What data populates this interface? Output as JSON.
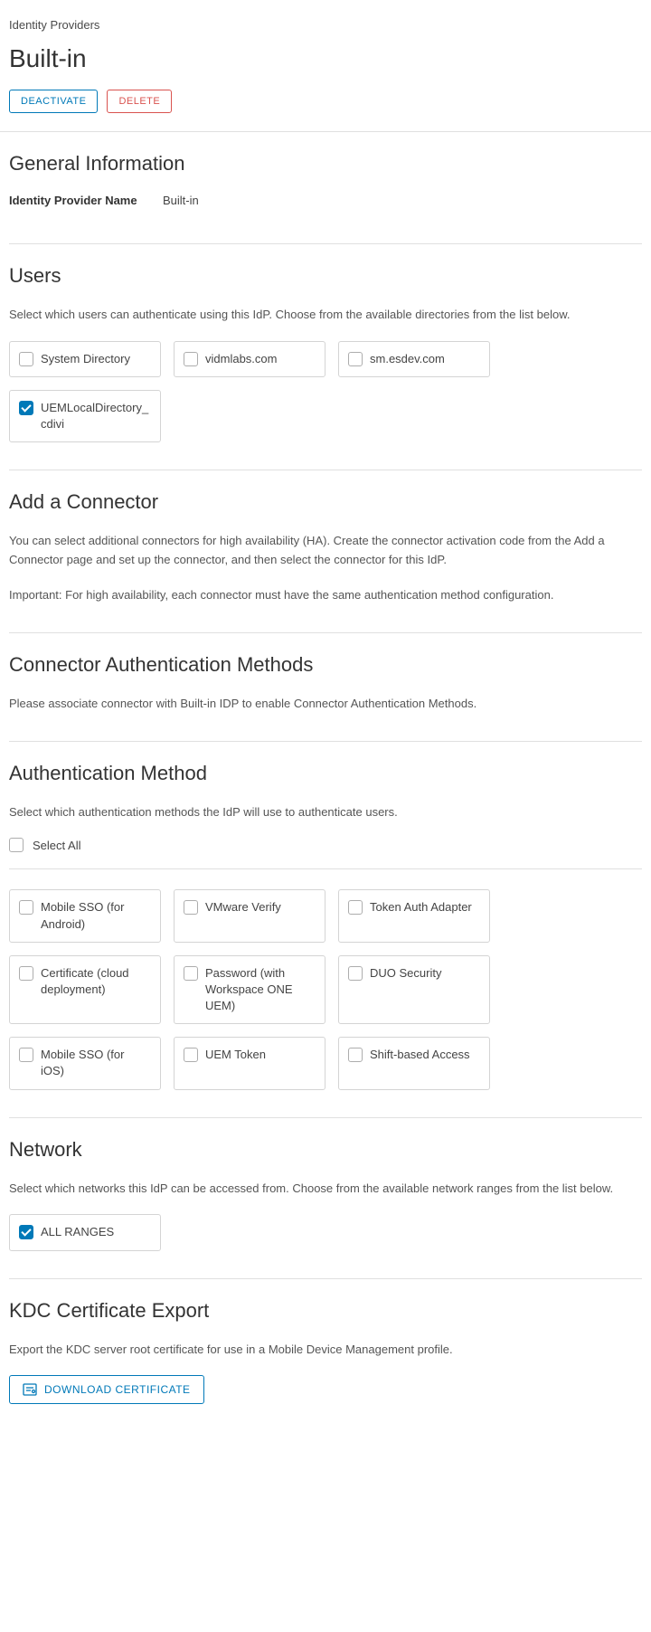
{
  "breadcrumb": "Identity Providers",
  "page_title": "Built-in",
  "actions": {
    "deactivate": "DEACTIVATE",
    "delete": "DELETE"
  },
  "general": {
    "heading": "General Information",
    "name_label": "Identity Provider Name",
    "name_value": "Built-in"
  },
  "users": {
    "heading": "Users",
    "desc": "Select which users can authenticate using this IdP. Choose from the available directories from the list below.",
    "items": [
      {
        "label": "System Directory",
        "checked": false
      },
      {
        "label": "vidmlabs.com",
        "checked": false
      },
      {
        "label": "sm.esdev.com",
        "checked": false
      },
      {
        "label": "UEMLocalDirectory_cdivi",
        "checked": true
      }
    ]
  },
  "connector": {
    "heading": "Add a Connector",
    "desc1": "You can select additional connectors for high availability (HA). Create the connector activation code from the Add a Connector page and set up the connector, and then select the connector for this IdP.",
    "desc2": "Important: For high availability, each connector must have the same authentication method configuration."
  },
  "conn_auth": {
    "heading": "Connector Authentication Methods",
    "desc": "Please associate connector with Built-in IDP to enable Connector Authentication Methods."
  },
  "auth_method": {
    "heading": "Authentication Method",
    "desc": "Select which authentication methods the IdP will use to authenticate users.",
    "select_all": "Select All",
    "items": [
      {
        "label": "Mobile SSO (for Android)",
        "checked": false
      },
      {
        "label": "VMware Verify",
        "checked": false
      },
      {
        "label": "Token Auth Adapter",
        "checked": false
      },
      {
        "label": "Certificate (cloud deployment)",
        "checked": false
      },
      {
        "label": "Password (with Workspace ONE UEM)",
        "checked": false
      },
      {
        "label": "DUO Security",
        "checked": false
      },
      {
        "label": "Mobile SSO (for iOS)",
        "checked": false
      },
      {
        "label": "UEM Token",
        "checked": false
      },
      {
        "label": "Shift-based Access",
        "checked": false
      }
    ]
  },
  "network": {
    "heading": "Network",
    "desc": "Select which networks this IdP can be accessed from. Choose from the available network ranges from the list below.",
    "items": [
      {
        "label": "ALL RANGES",
        "checked": true
      }
    ]
  },
  "kdc": {
    "heading": "KDC Certificate Export",
    "desc": "Export the KDC server root certificate for use in a Mobile Device Management profile.",
    "button": "DOWNLOAD CERTIFICATE"
  }
}
